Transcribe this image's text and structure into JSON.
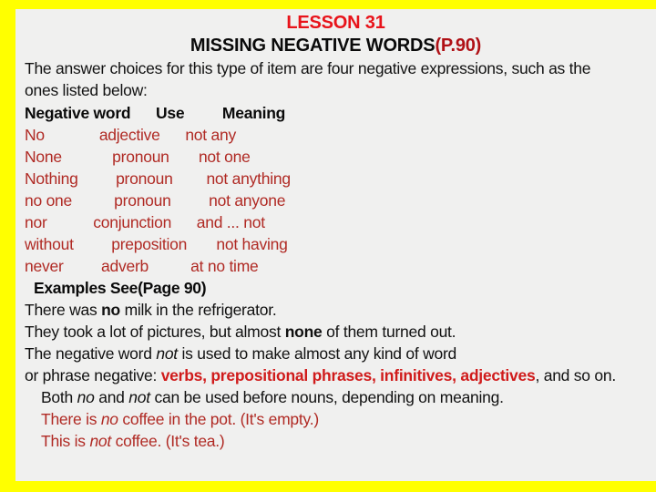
{
  "slide": {
    "border_color": "#FFFF00",
    "content_bg": "#F0F0EF",
    "title_lesson": "LESSON 31",
    "title_topic_main": "MISSING NEGATIVE WORDS",
    "title_topic_page_ref": "(P.90)",
    "title_lesson_color": "#E8131A",
    "title_page_ref_color": "#B01116",
    "body_color": "#111111",
    "table_text_color": "#B02A24",
    "highlight_red": "#D01B1B"
  },
  "intro": {
    "line1": "The answer choices for this type of item are four negative expressions, such as the",
    "line2": "ones listed below:"
  },
  "table": {
    "headers": {
      "word": "Negative word",
      "use": "Use",
      "meaning": "Meaning"
    },
    "header_row_raw": "Negative word      Use         Meaning",
    "rows": [
      {
        "word": "No",
        "use": "adjective",
        "meaning": "not any",
        "raw": "No             adjective      not any"
      },
      {
        "word": "None",
        "use": "pronoun",
        "meaning": "not one",
        "raw": "None            pronoun       not one"
      },
      {
        "word": "Nothing",
        "use": "pronoun",
        "meaning": "not anything",
        "raw": "Nothing         pronoun        not anything"
      },
      {
        "word": "no one",
        "use": "pronoun",
        "meaning": "not anyone",
        "raw": "no one          pronoun         not anyone"
      },
      {
        "word": "nor",
        "use": "conjunction",
        "meaning": "and ... not",
        "raw": "nor           conjunction      and ... not"
      },
      {
        "word": "without",
        "use": "preposition",
        "meaning": "not having",
        "raw": "without         preposition       not having"
      },
      {
        "word": "never",
        "use": "adverb",
        "meaning": "at no time",
        "raw": "never         adverb          at no time"
      }
    ]
  },
  "examples": {
    "heading": "Examples See(Page 90)",
    "line1_pre": "There was ",
    "line1_bold": "no",
    "line1_post": " milk in the refrigerator.",
    "line2_pre": "They took a lot of pictures, but almost ",
    "line2_bold": "none",
    "line2_post": " of them turned out.",
    "line3_pre": "The negative word ",
    "line3_italic": "not",
    "line3_post": " is used to make almost any kind of word",
    "line4_pre": "or phrase negative: ",
    "line4_highlight": "verbs, prepositional phrases, infinitives, adjectives",
    "line4_post": ", and so on.",
    "line5_pre": "Both ",
    "line5_italic1": "no",
    "line5_mid": " and ",
    "line5_italic2": "not",
    "line5_post": " can be used before nouns, depending on meaning.",
    "line6_pre": "There is ",
    "line6_italic": "no",
    "line6_post": " coffee in the pot. (It's empty.)",
    "line7_pre": "This is ",
    "line7_italic": "not",
    "line7_post": " coffee. (It's tea.)"
  }
}
